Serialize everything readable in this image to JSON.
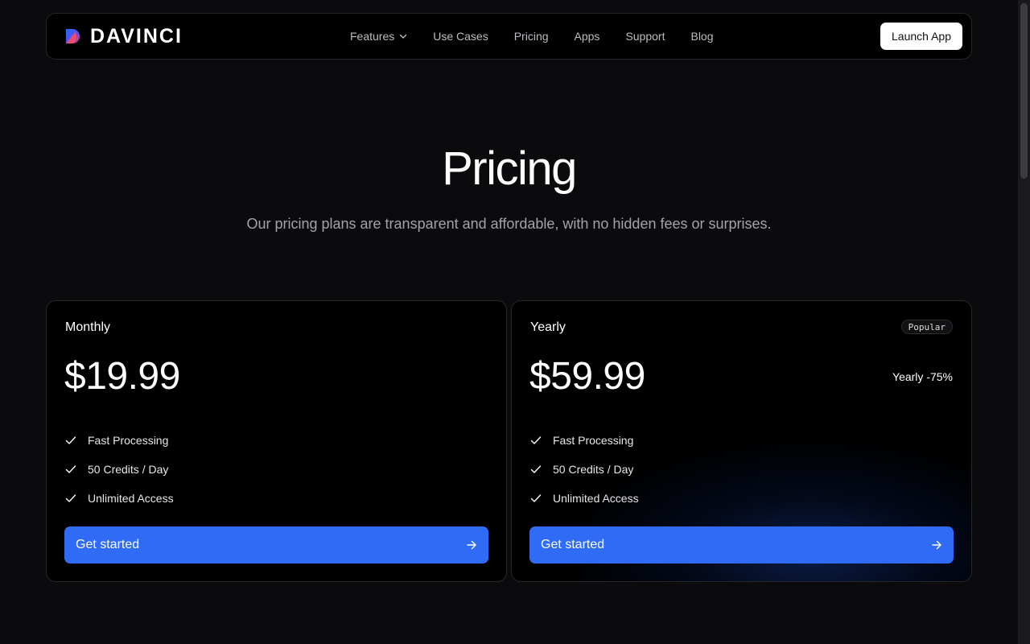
{
  "brand": {
    "name": "DAVINCI",
    "logo_icon": "davinci-logo-icon"
  },
  "nav": {
    "items": [
      {
        "label": "Features",
        "has_dropdown": true
      },
      {
        "label": "Use Cases"
      },
      {
        "label": "Pricing"
      },
      {
        "label": "Apps"
      },
      {
        "label": "Support"
      },
      {
        "label": "Blog"
      }
    ],
    "cta_label": "Launch App"
  },
  "hero": {
    "title": "Pricing",
    "subtitle": "Our pricing plans are transparent and affordable, with no hidden fees or surprises."
  },
  "plans": [
    {
      "name": "Monthly",
      "price": "$19.99",
      "features": [
        "Fast Processing",
        "50 Credits / Day",
        "Unlimited Access"
      ],
      "cta_label": "Get started"
    },
    {
      "name": "Yearly",
      "badge": "Popular",
      "price": "$59.99",
      "discount": "Yearly -75%",
      "features": [
        "Fast Processing",
        "50 Credits / Day",
        "Unlimited Access"
      ],
      "cta_label": "Get started"
    }
  ],
  "colors": {
    "background": "#0b0b0d",
    "card_background": "#000000",
    "accent": "#2f6bf5",
    "muted_text": "#a3a3aa"
  }
}
